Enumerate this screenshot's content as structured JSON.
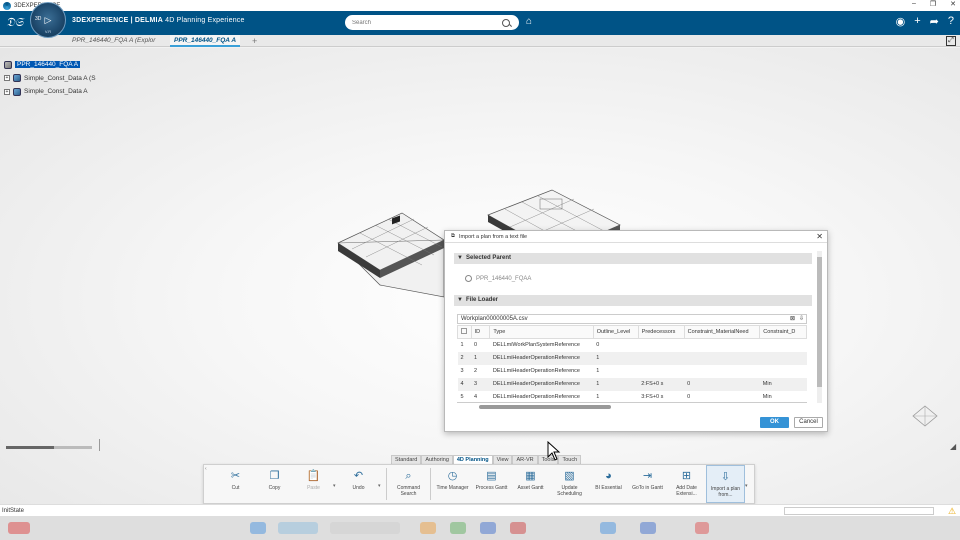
{
  "window": {
    "title": "3DEXPERIENCE",
    "controls": [
      "–",
      "❐",
      "✕"
    ]
  },
  "header": {
    "brand_bold": "3DEXPERIENCE | DELMIA",
    "brand_rest": " 4D Planning Experience",
    "compass_top": "3D",
    "compass_version": "V.R",
    "search_placeholder": "Search"
  },
  "tabs": [
    {
      "label": "PPR_146440_FQA A (Explor"
    },
    {
      "label": "PPR_146440_FQA A"
    }
  ],
  "tree": {
    "items": [
      {
        "label": "PPR_146440_FQA A"
      },
      {
        "label": "Simple_Const_Data A (S"
      },
      {
        "label": "Simple_Const_Data A"
      }
    ]
  },
  "dialog": {
    "title": "Import a plan from a text file",
    "selected_parent_header": "Selected Parent",
    "parent_value": "PPR_146440_FQAA",
    "file_loader_header": "File Loader",
    "file_name": "Workplan00000005A.csv",
    "columns": [
      "",
      "ID",
      "Type",
      "Outline_Level",
      "Predecessors",
      "Constraint_MaterialNeed",
      "Constraint_D"
    ],
    "rows": [
      [
        "1",
        "0",
        "DELLmiWorkPlanSystemReference",
        "0",
        "",
        "",
        ""
      ],
      [
        "2",
        "1",
        "DELLmiHeaderOperationReference",
        "1",
        "",
        "",
        ""
      ],
      [
        "3",
        "2",
        "DELLmiHeaderOperationReference",
        "1",
        "",
        "",
        ""
      ],
      [
        "4",
        "3",
        "DELLmiHeaderOperationReference",
        "1",
        "2:FS+0 s",
        "0",
        "Min"
      ],
      [
        "5",
        "4",
        "DELLmiHeaderOperationReference",
        "1",
        "3:FS+0 s",
        "0",
        "Min"
      ]
    ],
    "ok_label": "OK",
    "cancel_label": "Cancel"
  },
  "action_bar": {
    "tabs": [
      "Standard",
      "Authoring",
      "4D Planning",
      "View",
      "AR-VR",
      "Tools",
      "Touch"
    ],
    "active_tab": "4D Planning",
    "buttons": [
      {
        "label": "Cut",
        "icon": "scissors-icon",
        "glyph": "✂"
      },
      {
        "label": "Copy",
        "icon": "copy-icon",
        "glyph": "❐"
      },
      {
        "label": "Paste",
        "icon": "paste-icon",
        "glyph": "📋"
      },
      {
        "label": "Undo",
        "icon": "undo-icon",
        "glyph": "↶"
      },
      {
        "label": "Command Search",
        "icon": "command-search-icon",
        "glyph": "⌕"
      },
      {
        "label": "Time Manager",
        "icon": "time-manager-icon",
        "glyph": "◷"
      },
      {
        "label": "Process Gantt",
        "icon": "process-gantt-icon",
        "glyph": "▤"
      },
      {
        "label": "Asset Gantt",
        "icon": "asset-gantt-icon",
        "glyph": "▦"
      },
      {
        "label": "Update Scheduling",
        "icon": "update-scheduling-icon",
        "glyph": "▧"
      },
      {
        "label": "BI Essential",
        "icon": "bi-essential-icon",
        "glyph": "◕"
      },
      {
        "label": "GoTo in Gantt",
        "icon": "goto-gantt-icon",
        "glyph": "⇥"
      },
      {
        "label": "Add Date Extensi...",
        "icon": "add-date-extension-icon",
        "glyph": "⊞"
      },
      {
        "label": "Import a plan from...",
        "icon": "import-plan-icon",
        "glyph": "⇩"
      }
    ]
  },
  "status": {
    "text": "InitState"
  },
  "slider": {
    "value_fraction": 0.56
  }
}
